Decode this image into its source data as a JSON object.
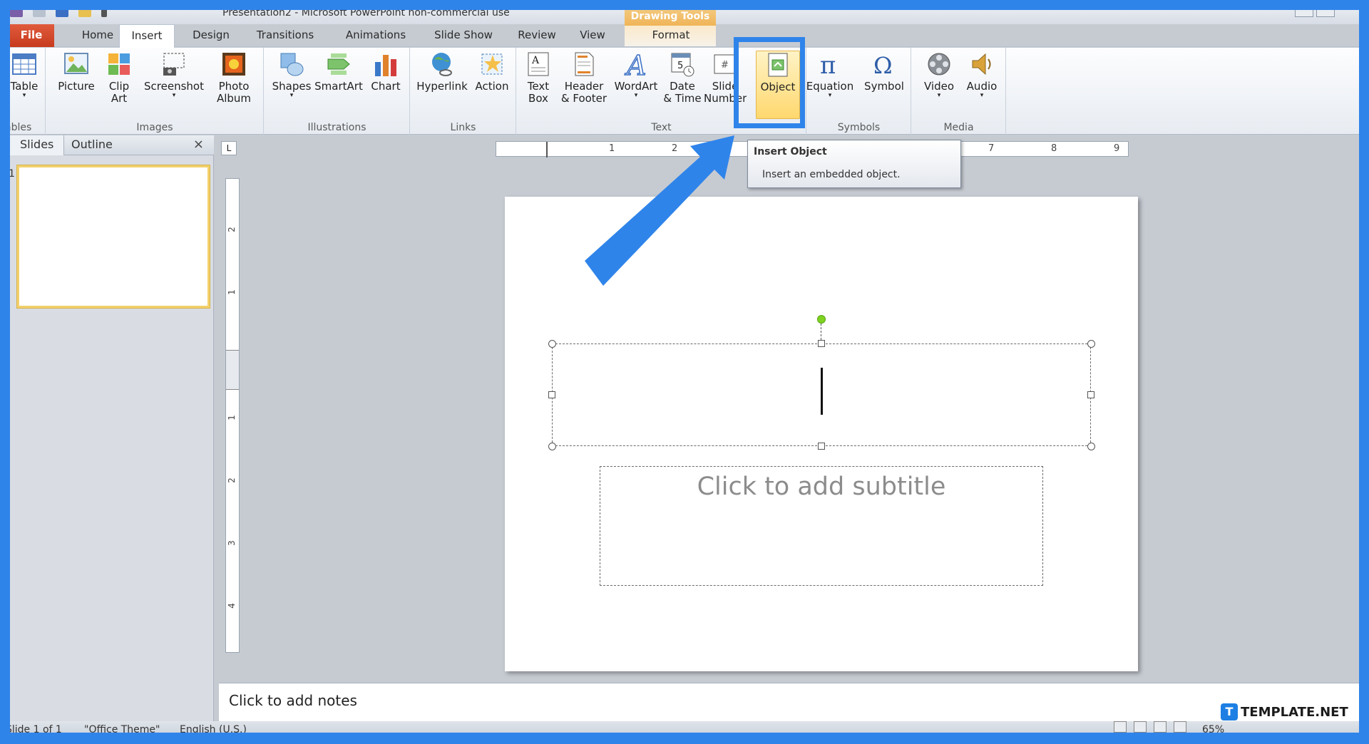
{
  "window": {
    "title": "Presentation2 - Microsoft PowerPoint non-commercial use"
  },
  "context_tab_group": {
    "label": "Drawing Tools"
  },
  "tabs": [
    {
      "label": "File"
    },
    {
      "label": "Home"
    },
    {
      "label": "Insert"
    },
    {
      "label": "Design"
    },
    {
      "label": "Transitions"
    },
    {
      "label": "Animations"
    },
    {
      "label": "Slide Show"
    },
    {
      "label": "Review"
    },
    {
      "label": "View"
    },
    {
      "label": "Format"
    }
  ],
  "active_tab": "Insert",
  "ribbon": {
    "groups": {
      "tables": "Tables",
      "images": "Images",
      "illustrations": "Illustrations",
      "links": "Links",
      "text": "Text",
      "symbols": "Symbols",
      "media": "Media"
    },
    "buttons": {
      "table": "Table",
      "picture": "Picture",
      "clip_art_1": "Clip",
      "clip_art_2": "Art",
      "screenshot": "Screenshot",
      "photo_album_1": "Photo",
      "photo_album_2": "Album",
      "shapes": "Shapes",
      "smartart": "SmartArt",
      "chart": "Chart",
      "hyperlink": "Hyperlink",
      "action": "Action",
      "text_box_1": "Text",
      "text_box_2": "Box",
      "header_footer_1": "Header",
      "header_footer_2": "& Footer",
      "wordart": "WordArt",
      "date_time_1": "Date",
      "date_time_2": "& Time",
      "slide_number_1": "Slide",
      "slide_number_2": "Number",
      "object": "Object",
      "equation": "Equation",
      "symbol": "Symbol",
      "video": "Video",
      "audio": "Audio"
    }
  },
  "tooltip": {
    "title": "Insert Object",
    "description": "Insert an embedded object."
  },
  "left_pane": {
    "tabs": [
      "Slides",
      "Outline"
    ],
    "close": "×",
    "slide_number": "1"
  },
  "ruler": {
    "corner": "L",
    "h_labels": [
      "1",
      "2",
      "7",
      "8",
      "9"
    ],
    "v_labels": [
      "2",
      "1",
      "1",
      "2",
      "3",
      "4"
    ]
  },
  "slide": {
    "subtitle_placeholder": "Click to add subtitle"
  },
  "notes": {
    "placeholder": "Click to add notes"
  },
  "status": {
    "slide": "Slide 1 of 1",
    "theme": "\"Office Theme\"",
    "language": "English (U.S.)",
    "zoom": "65%"
  },
  "watermark": {
    "logo": "T",
    "text": "TEMPLATE.NET"
  },
  "colors": {
    "highlight": "#2f84ea",
    "file_tab": "#c73a1c",
    "object_button": "#ffd86e"
  }
}
